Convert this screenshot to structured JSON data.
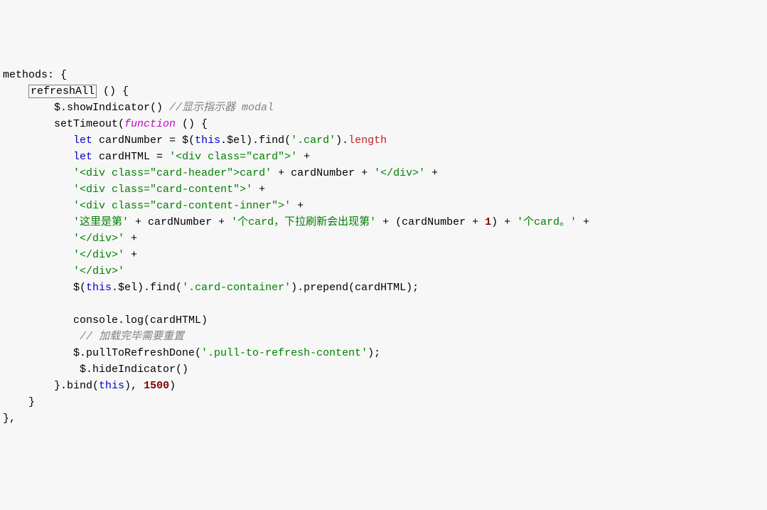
{
  "code": {
    "l1_a": "methods: {",
    "l2_indent": "    ",
    "l2_box": "refreshAll",
    "l2_after": " () {",
    "l3_a": "        $.showIndicator() ",
    "l3_com": "//显示指示器 modal",
    "l4_a": "        setTimeout(",
    "l4_fn": "function",
    "l4_b": " () {",
    "l5_a": "           ",
    "l5_let": "let",
    "l5_b": " cardNumber = $(",
    "l5_this": "this",
    "l5_c": ".$el).find(",
    "l5_str": "'.card'",
    "l5_d": ").",
    "l5_len": "length",
    "l6_a": "           ",
    "l6_let": "let",
    "l6_b": " cardHTML = ",
    "l6_str": "'<div class=\"card\">'",
    "l6_c": " +",
    "l7_a": "           ",
    "l7_str": "'<div class=\"card-header\">card'",
    "l7_b": " + cardNumber + ",
    "l7_str2": "'</div>'",
    "l7_c": " +",
    "l8_a": "           ",
    "l8_str": "'<div class=\"card-content\">'",
    "l8_b": " +",
    "l9_a": "           ",
    "l9_str": "'<div class=\"card-content-inner\">'",
    "l9_b": " +",
    "l10_a": "           ",
    "l10_str1": "'这里是第'",
    "l10_b": " + cardNumber + ",
    "l10_str2": "'个card，下拉刷新会出现第'",
    "l10_c": " + (cardNumber + ",
    "l10_num": "1",
    "l10_d": ") + ",
    "l10_str3": "'个card。'",
    "l10_e": " +",
    "l11_a": "           ",
    "l11_str": "'</div>'",
    "l11_b": " +",
    "l12_a": "           ",
    "l12_str": "'</div>'",
    "l12_b": " +",
    "l13_a": "           ",
    "l13_str": "'</div>'",
    "l14_a": "           $(",
    "l14_this": "this",
    "l14_b": ".$el).find(",
    "l14_str": "'.card-container'",
    "l14_c": ").prepend(cardHTML);",
    "l15_a": "",
    "l16_a": "           console.log(cardHTML)",
    "l17_a": "            ",
    "l17_com": "// 加载完毕需要重置",
    "l18_a": "           $.pullToRefreshDone(",
    "l18_str": "'.pull-to-refresh-content'",
    "l18_b": ");",
    "l19_a": "            $.hideIndicator()",
    "l20_a": "        }.bind(",
    "l20_this": "this",
    "l20_b": "), ",
    "l20_num": "1500",
    "l20_c": ")",
    "l21_a": "    }",
    "l22_a": "},"
  }
}
